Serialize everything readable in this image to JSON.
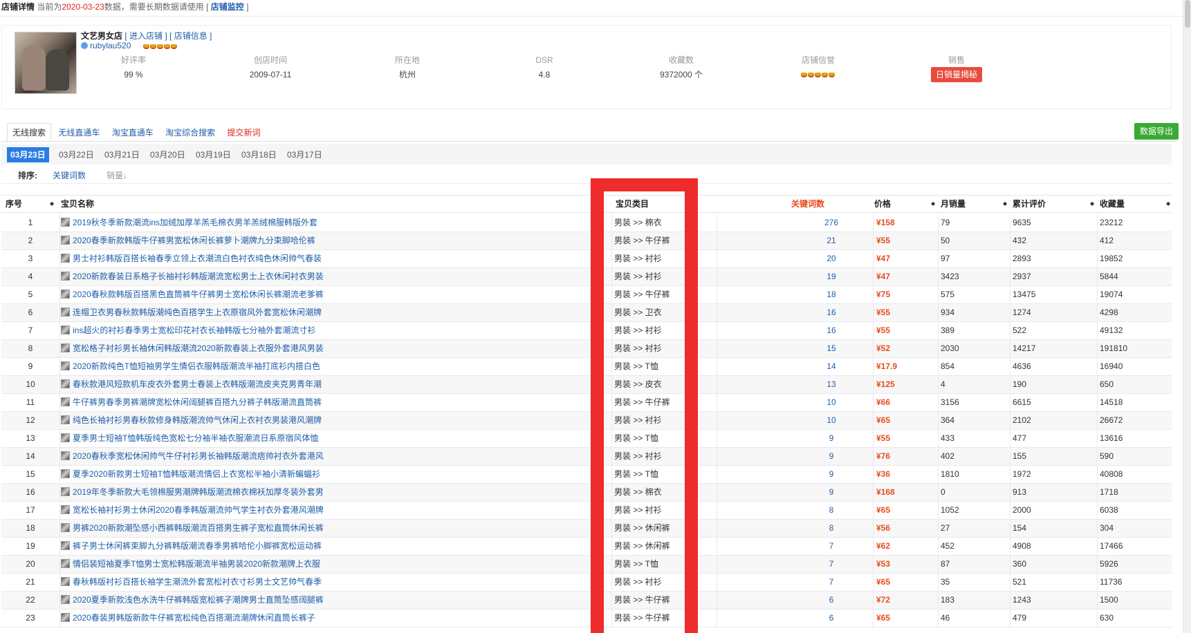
{
  "header": {
    "title": "店铺详情",
    "prefix": "当前为",
    "date": "2020-03-23",
    "suffix": "数据，需要长期数据请使用 [",
    "monitor_link": "店铺监控",
    "close": "]"
  },
  "shop": {
    "name": "文艺男女店",
    "enter_link": "[ 进入店铺 ]",
    "info_link": "[ 店铺信息 ]",
    "owner": "rubylau520",
    "stats": [
      {
        "label": "好评率",
        "value": "99 %"
      },
      {
        "label": "创店时间",
        "value": "2009-07-11"
      },
      {
        "label": "所在地",
        "value": "杭州"
      },
      {
        "label": "DSR",
        "value": "4.8"
      },
      {
        "label": "收藏数",
        "value": "9372000 个"
      },
      {
        "label": "店铺信誉",
        "value": ""
      },
      {
        "label": "销售",
        "value": ""
      }
    ],
    "sales_button": "日销量揭秘"
  },
  "tabs": [
    {
      "label": "无线搜索",
      "active": true
    },
    {
      "label": "无线直通车"
    },
    {
      "label": "淘宝直通车"
    },
    {
      "label": "淘宝综合搜索"
    },
    {
      "label": "提交新词",
      "red": true
    }
  ],
  "export_button": "数据导出",
  "dates": [
    "03月23日",
    "03月22日",
    "03月21日",
    "03月20日",
    "03月19日",
    "03月18日",
    "03月17日"
  ],
  "sort": {
    "label": "排序:",
    "options": [
      "关键词数",
      "销量↓"
    ]
  },
  "table": {
    "headers": {
      "no": "序号",
      "name": "宝贝名称",
      "category": "宝贝类目",
      "keywords": "关键词数",
      "price": "价格",
      "monthly": "月销量",
      "reviews": "累计评价",
      "favorites": "收藏量"
    },
    "rows": [
      {
        "no": "1",
        "name": "2019秋冬季新款潮流ins加绒加厚羊羔毛棉衣男羊羔绒棉服韩版外套",
        "category": "男装 >> 棉衣",
        "keywords": "276",
        "price": "¥158",
        "monthly": "79",
        "reviews": "9635",
        "favorites": "23212"
      },
      {
        "no": "2",
        "name": "2020春季新款韩版牛仔裤男宽松休闲长裤萝卜潮牌九分束脚哈伦裤",
        "category": "男装 >> 牛仔裤",
        "keywords": "21",
        "price": "¥55",
        "monthly": "50",
        "reviews": "432",
        "favorites": "412"
      },
      {
        "no": "3",
        "name": "男士衬衫韩版百搭长袖春季立领上衣潮流白色衬衣纯色休闲帅气春装",
        "category": "男装 >> 衬衫",
        "keywords": "20",
        "price": "¥47",
        "monthly": "97",
        "reviews": "2893",
        "favorites": "19852"
      },
      {
        "no": "4",
        "name": "2020新款春装日系格子长袖衬衫韩版潮流宽松男士上衣休闲衬衣男装",
        "category": "男装 >> 衬衫",
        "keywords": "19",
        "price": "¥47",
        "monthly": "3423",
        "reviews": "2937",
        "favorites": "5844"
      },
      {
        "no": "5",
        "name": "2020春秋款韩版百搭黑色直筒裤牛仔裤男士宽松休闲长裤潮流老爹裤",
        "category": "男装 >> 牛仔裤",
        "keywords": "18",
        "price": "¥75",
        "monthly": "575",
        "reviews": "13475",
        "favorites": "19074"
      },
      {
        "no": "6",
        "name": "连帽卫衣男春秋款韩版潮纯色百搭学生上衣原宿风外套宽松休闲潮牌",
        "category": "男装 >> 卫衣",
        "keywords": "16",
        "price": "¥55",
        "monthly": "934",
        "reviews": "1274",
        "favorites": "4298"
      },
      {
        "no": "7",
        "name": "ins超火的衬衫春季男士宽松印花衬衣长袖韩版七分袖外套潮流寸衫",
        "category": "男装 >> 衬衫",
        "keywords": "16",
        "price": "¥55",
        "monthly": "389",
        "reviews": "522",
        "favorites": "49132"
      },
      {
        "no": "8",
        "name": "宽松格子衬衫男长袖休闲韩版潮流2020新款春装上衣服外套港风男装",
        "category": "男装 >> 衬衫",
        "keywords": "15",
        "price": "¥52",
        "monthly": "2030",
        "reviews": "14217",
        "favorites": "191810"
      },
      {
        "no": "9",
        "name": "2020新款纯色T恤短袖男学生情侣衣服韩版潮流半袖打底衫内搭白色",
        "category": "男装 >> T恤",
        "keywords": "14",
        "price": "¥17.9",
        "monthly": "854",
        "reviews": "4636",
        "favorites": "16940"
      },
      {
        "no": "10",
        "name": "春秋款港风短款机车皮衣外套男士春装上衣韩版潮流皮夹克男青年潮",
        "category": "男装 >> 皮衣",
        "keywords": "13",
        "price": "¥125",
        "monthly": "4",
        "reviews": "190",
        "favorites": "650"
      },
      {
        "no": "11",
        "name": "牛仔裤男春季男裤潮牌宽松休闲阔腿裤百搭九分裤子韩版潮流直筒裤",
        "category": "男装 >> 牛仔裤",
        "keywords": "10",
        "price": "¥66",
        "monthly": "3156",
        "reviews": "6615",
        "favorites": "14518"
      },
      {
        "no": "12",
        "name": "纯色长袖衬衫男春秋款修身韩版潮流帅气休闲上衣衬衣男装港风潮牌",
        "category": "男装 >> 衬衫",
        "keywords": "10",
        "price": "¥65",
        "monthly": "364",
        "reviews": "2102",
        "favorites": "26672"
      },
      {
        "no": "13",
        "name": "夏季男士短袖T恤韩版纯色宽松七分袖半袖衣服潮流日系原宿风体恤",
        "category": "男装 >> T恤",
        "keywords": "9",
        "price": "¥55",
        "monthly": "433",
        "reviews": "477",
        "favorites": "13616"
      },
      {
        "no": "14",
        "name": "2020春秋季宽松休闲帅气牛仔衬衫男长袖韩版潮流痞帅衬衣外套港风",
        "category": "男装 >> 衬衫",
        "keywords": "9",
        "price": "¥76",
        "monthly": "402",
        "reviews": "155",
        "favorites": "590"
      },
      {
        "no": "15",
        "name": "夏季2020新款男士短袖T恤韩版潮流情侣上衣宽松半袖小清新蝙蝠衫",
        "category": "男装 >> T恤",
        "keywords": "9",
        "price": "¥36",
        "monthly": "1810",
        "reviews": "1972",
        "favorites": "40808"
      },
      {
        "no": "16",
        "name": "2019年冬季新款大毛领棉服男潮牌韩版潮流棉衣棉袄加厚冬装外套男",
        "category": "男装 >> 棉衣",
        "keywords": "9",
        "price": "¥168",
        "monthly": "0",
        "reviews": "913",
        "favorites": "1718"
      },
      {
        "no": "17",
        "name": "宽松长袖衬衫男士休闲2020春季韩版潮流帅气学生衬衣外套港风潮牌",
        "category": "男装 >> 衬衫",
        "keywords": "8",
        "price": "¥65",
        "monthly": "1052",
        "reviews": "2000",
        "favorites": "6038"
      },
      {
        "no": "18",
        "name": "男裤2020新款潮坠感小西裤韩版潮流百搭男生裤子宽松直筒休闲长裤",
        "category": "男装 >> 休闲裤",
        "keywords": "8",
        "price": "¥56",
        "monthly": "27",
        "reviews": "154",
        "favorites": "304"
      },
      {
        "no": "19",
        "name": "裤子男士休闲裤束脚九分裤韩版潮流春季男裤哈伦小脚裤宽松运动裤",
        "category": "男装 >> 休闲裤",
        "keywords": "7",
        "price": "¥62",
        "monthly": "452",
        "reviews": "4908",
        "favorites": "17466"
      },
      {
        "no": "20",
        "name": "情侣装短袖夏季T恤男士宽松韩版潮流半袖男装2020新款潮牌上衣服",
        "category": "男装 >> T恤",
        "keywords": "7",
        "price": "¥53",
        "monthly": "87",
        "reviews": "360",
        "favorites": "5926"
      },
      {
        "no": "21",
        "name": "春秋韩版衬衫百搭长袖学生潮流外套宽松衬衣寸衫男士文艺帅气春季",
        "category": "男装 >> 衬衫",
        "keywords": "7",
        "price": "¥65",
        "monthly": "35",
        "reviews": "521",
        "favorites": "11736"
      },
      {
        "no": "22",
        "name": "2020夏季新款浅色水洗牛仔裤韩版宽松裤子潮牌男士直筒坠感阔腿裤",
        "category": "男装 >> 牛仔裤",
        "keywords": "6",
        "price": "¥72",
        "monthly": "183",
        "reviews": "1243",
        "favorites": "1500"
      },
      {
        "no": "23",
        "name": "2020春装男韩版新款牛仔裤宽松纯色百搭潮流潮牌休闲直筒长裤子",
        "category": "男装 >> 牛仔裤",
        "keywords": "6",
        "price": "¥65",
        "monthly": "46",
        "reviews": "479",
        "favorites": "630"
      }
    ]
  },
  "colors": {
    "highlight": "#ef2b2b",
    "link": "#1f5ea8",
    "price": "#e94c1d",
    "active_date": "#2c7be5",
    "export": "#3aaa35"
  }
}
